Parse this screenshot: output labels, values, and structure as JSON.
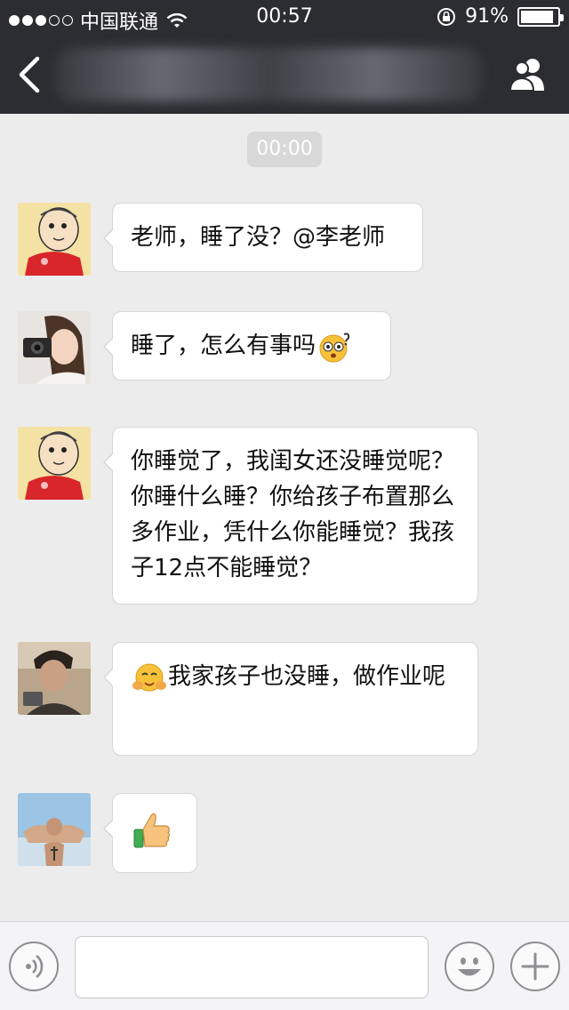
{
  "status_bar": {
    "carrier": "中国联通",
    "time": "00:57",
    "battery_percent": "91%",
    "battery_level": 0.91,
    "signal_bars_filled": 3,
    "signal_bars_total": 5
  },
  "nav": {
    "back_icon": "chevron-left-icon",
    "contacts_icon": "group-contacts-icon",
    "background": "#2c2d31"
  },
  "chat": {
    "timestamp": "00:00",
    "messages": [
      {
        "sender": "parent-a",
        "text": "老师，睡了没？@李老师"
      },
      {
        "sender": "teacher",
        "text": "睡了，怎么有事吗",
        "trailing_emoji": "dizzy-face-emoji"
      },
      {
        "sender": "parent-a",
        "text": "你睡觉了，我闺女还没睡觉呢？你睡什么睡？你给孩子布置那么多作业，凭什么你能睡觉？我孩子12点不能睡觉？"
      },
      {
        "sender": "parent-b",
        "text": "我家孩子也没睡，做作业呢",
        "leading_emoji": "hugging-face-emoji"
      },
      {
        "sender": "parent-c",
        "text": "",
        "emoji": "thumbs-up-emoji"
      }
    ]
  },
  "input_bar": {
    "voice_icon": "voice-icon",
    "emoji_icon": "smiley-icon",
    "plus_icon": "plus-icon",
    "text_value": ""
  }
}
